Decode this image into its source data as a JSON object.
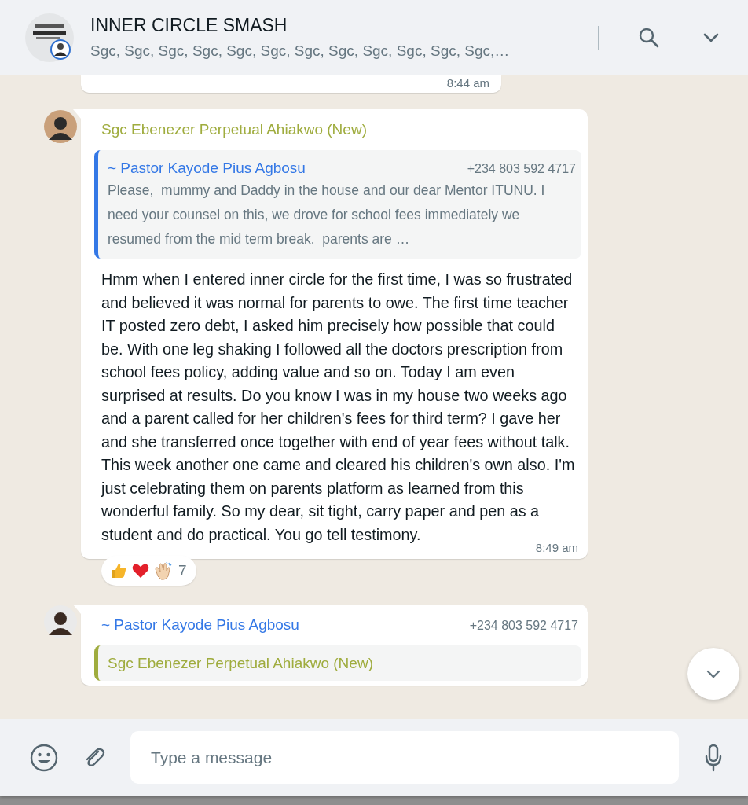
{
  "header": {
    "title": "INNER CIRCLE SMASH",
    "subtitle": "Sgc, Sgc, Sgc, Sgc, Sgc, Sgc, Sgc, Sgc, Sgc, Sgc, Sgc, Sgc,…"
  },
  "messages": [
    {
      "kind": "fragment",
      "time": "8:44 am"
    },
    {
      "kind": "message",
      "sender": "Sgc Ebenezer Perpetual Ahiakwo (New)",
      "color": "#9fac3e",
      "quote": {
        "author": "~ Pastor Kayode Pius Agbosu",
        "phone": "+234 803 592 4717",
        "color": "#3478e6",
        "text": "Please,  mummy and Daddy in the house and our dear Mentor ITUNU. I  need your counsel on this, we drove for school fees immediately we resumed from the mid term break.  parents are …"
      },
      "text": "Hmm when I entered inner circle for the first time, I was so frustrated and believed it was normal for parents to owe. The first time teacher IT posted zero debt, I asked him precisely how possible that could be. With one leg shaking I followed all the doctors prescription from school fees policy, adding value and so on. Today I am even surprised at results. Do you know I was in my house two weeks ago and a parent called for her children's fees for third term? I gave her and she transferred once together with end of year fees without talk. This week another one came and cleared his children's own also. I'm just celebrating them on parents platform as learned from this wonderful family. So my dear, sit tight, carry paper and pen as a student and do practical. You go tell testimony.",
      "time": "8:49 am",
      "reactions": {
        "count": "7"
      }
    },
    {
      "kind": "message",
      "sender": "~ Pastor Kayode Pius Agbosu",
      "phone": "+234 803 592 4717",
      "color": "#3478e6",
      "quote": {
        "author": "Sgc Ebenezer Perpetual Ahiakwo (New)",
        "color": "#9fac3e"
      }
    }
  ],
  "composer": {
    "placeholder": "Type a message"
  }
}
